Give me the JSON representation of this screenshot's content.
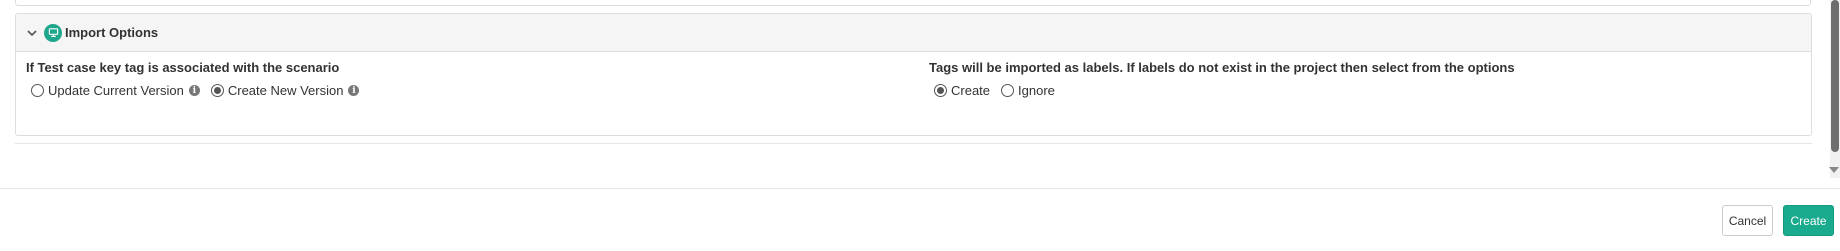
{
  "import_options": {
    "title": "Import Options",
    "icon": "import-options-icon",
    "accent_color": "#1ea78c",
    "expanded": true
  },
  "test_case_key": {
    "label": "If Test case key tag is associated with the scenario",
    "options": [
      {
        "label": "Update Current Version",
        "checked": false,
        "has_info": true
      },
      {
        "label": "Create New Version",
        "checked": true,
        "has_info": true
      }
    ]
  },
  "tags": {
    "label": "Tags will be imported as labels. If labels do not exist in the project then select from the options",
    "options": [
      {
        "label": "Create",
        "checked": true
      },
      {
        "label": "Ignore",
        "checked": false
      }
    ]
  },
  "footer": {
    "cancel_label": "Cancel",
    "create_label": "Create",
    "primary_color": "#1aaa8d"
  }
}
